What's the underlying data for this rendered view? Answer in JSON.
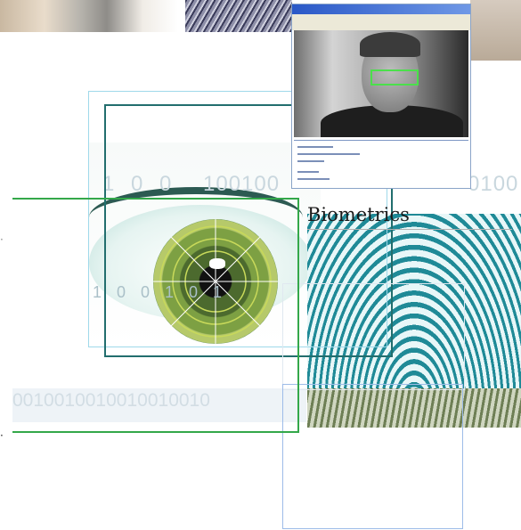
{
  "title": "Biometrics",
  "digits": {
    "top_row": "1 0 0",
    "mid_row": "100100",
    "iris_row": "1 0 0 1 0 1",
    "right_row": "0100",
    "bottom_row": "0010010010010010010"
  },
  "colors": {
    "green_line": "#34a84a",
    "teal_frame": "#226e6e",
    "cyan_frame": "#9fd9ea",
    "detection_box": "#4be04b"
  }
}
